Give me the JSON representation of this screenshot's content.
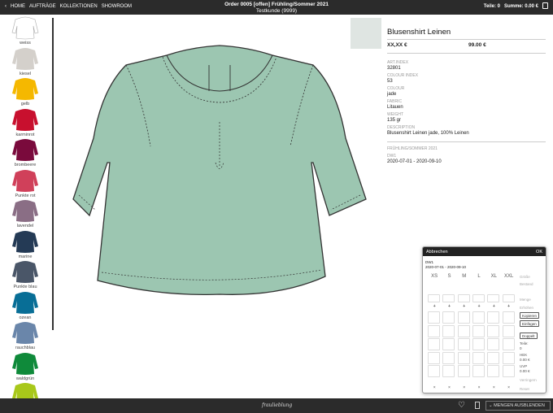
{
  "topbar": {
    "nav": [
      "HOME",
      "AUFTRÄGE",
      "KOLLEKTIONEN",
      "SHOWROOM"
    ],
    "order_title": "Order 0005 [offen] Frühling/Sommer 2021",
    "customer": "Testkunde (9999)",
    "teile": "Teile: 0",
    "summe": "Summe: 0.00 €"
  },
  "sidebar": {
    "colors": [
      {
        "label": "weiss",
        "hex": "#ffffff"
      },
      {
        "label": "kiesel",
        "hex": "#d4d0cb"
      },
      {
        "label": "gelb",
        "hex": "#f5b800"
      },
      {
        "label": "karminrot",
        "hex": "#c8102e"
      },
      {
        "label": "brombeere",
        "hex": "#7a0a3c"
      },
      {
        "label": "Punkte rot",
        "hex": "#d0405a"
      },
      {
        "label": "lavendel",
        "hex": "#8a6e85"
      },
      {
        "label": "marine",
        "hex": "#243a55"
      },
      {
        "label": "Punkte blau",
        "hex": "#4a5668"
      },
      {
        "label": "ozean",
        "hex": "#086e96"
      },
      {
        "label": "rauchblau",
        "hex": "#6a86aa"
      },
      {
        "label": "waldgrün",
        "hex": "#0f8a3a"
      },
      {
        "label": "",
        "hex": "#a8c81a"
      }
    ]
  },
  "product": {
    "title": "Blusenshirt Leinen",
    "price_ek": "XX,XX €",
    "price_uvp": "99.00 €",
    "color_hex": "#9cc6b1",
    "fields": [
      {
        "label": "ART.INDEX",
        "value": "32801"
      },
      {
        "label": "COLOUR INDEX",
        "value": "53"
      },
      {
        "label": "COLOUR",
        "value": "jade"
      },
      {
        "label": "FABRIC",
        "value": "Litauen"
      },
      {
        "label": "WEIGHT",
        "value": "135 gr"
      },
      {
        "label": "DESCRIPTION",
        "value": "Blusenshirt Leinen jade, 100% Leinen"
      }
    ],
    "season": "FRÜHLING/SOMMER 2021",
    "delivery_label": "DW1",
    "delivery_dates": "2020-07-01 - 2020-09-10"
  },
  "popup": {
    "cancel": "Abbrechen",
    "ok": "OK",
    "delivery_label": "DW1",
    "delivery_dates": "2020-07-01 - 2020-09-10",
    "sizes": [
      "XS",
      "S",
      "M",
      "L",
      "XL",
      "XXL"
    ],
    "labels": {
      "groesse": "Größe",
      "bestand": "Bestand",
      "menge": "Menge",
      "erhoehen": "Erhöhen",
      "verringern": "Verringern",
      "reset": "Reset"
    },
    "buttons": {
      "kopieren": "Kopieren",
      "einfuegen": "Einfügen",
      "doppelt": "Doppelt"
    },
    "teile_label": "Teile:",
    "teile_value": "0",
    "hek_label": "HEK",
    "hek_value": "0.00 €",
    "uvp_label": "UVP",
    "uvp_value": "0.00 €",
    "plus": "+",
    "x": "×"
  },
  "bottombar": {
    "logo": "fraulieblung",
    "hide_button": "MENGEN AUSBLENDEN"
  }
}
